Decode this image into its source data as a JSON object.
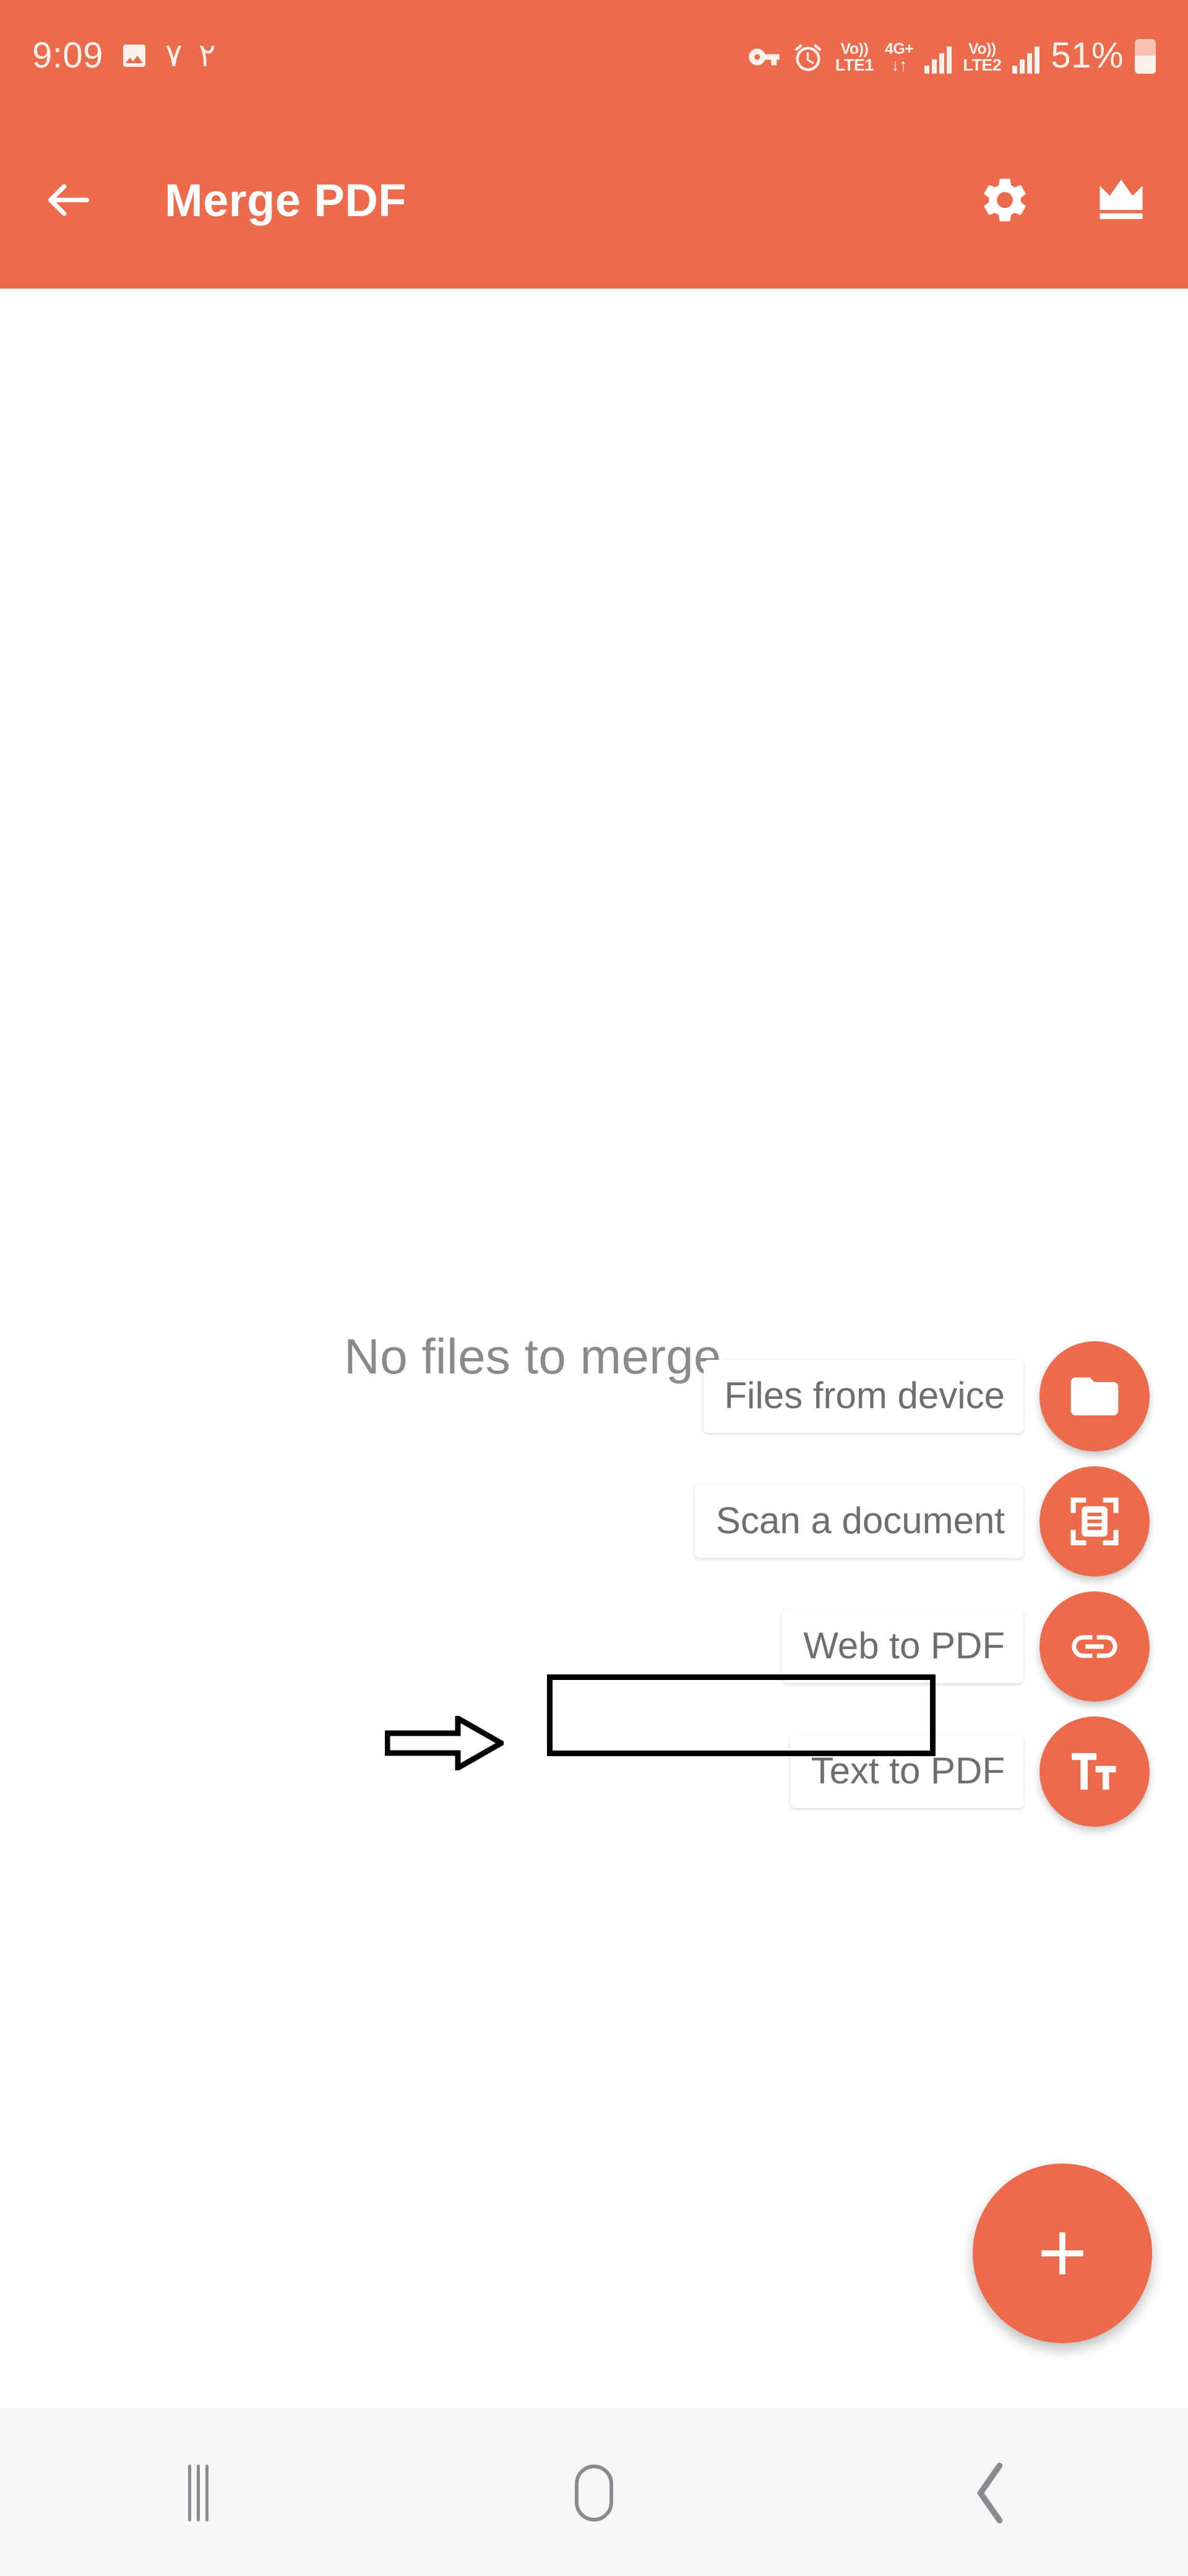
{
  "theme": {
    "accent": "#ec6b4c",
    "accent_light": "#fdf1ec",
    "label_text": "#6e6e6e",
    "empty_text": "#8a8a8a",
    "nav_background": "#f6f6f7",
    "nav_icon": "#8b8b8f",
    "annotation": "#000000"
  },
  "status_bar": {
    "time": "9:09",
    "left_icons": [
      "image-icon"
    ],
    "persian_digits": [
      "۷",
      "۲"
    ],
    "right_icons": [
      "vpn-key-icon",
      "alarm-icon"
    ],
    "sim1": {
      "volte_label": "Vo))",
      "network_label": "LTE1",
      "bars": 4
    },
    "data": {
      "type_label": "4G+",
      "arrows_label": "↓↑"
    },
    "sim2": {
      "volte_label": "Vo))",
      "network_label": "LTE2",
      "bars": 4
    },
    "battery_percent": "51%",
    "battery_level": 51
  },
  "app_bar": {
    "back_icon": "arrow-back-icon",
    "title": "Merge PDF",
    "actions": [
      {
        "name": "settings",
        "icon": "gear-icon"
      },
      {
        "name": "premium",
        "icon": "crown-icon"
      }
    ]
  },
  "main": {
    "empty_state_text": "No files to merge",
    "speed_dial": [
      {
        "label": "Files from device",
        "icon": "folder-icon"
      },
      {
        "label": "Scan a document",
        "icon": "document-scanner-icon"
      },
      {
        "label": "Web to PDF",
        "icon": "link-icon"
      },
      {
        "label": "Text to PDF",
        "icon": "text-format-icon"
      }
    ],
    "main_fab": {
      "icon": "plus-icon",
      "label": "Add"
    }
  },
  "annotations": {
    "highlight_target": "Files from device",
    "arrow_icon": "block-arrow-right-icon",
    "box_icon": "highlight-rectangle"
  },
  "nav_bar": {
    "buttons": [
      {
        "name": "recents",
        "icon": "recents-icon"
      },
      {
        "name": "home",
        "icon": "home-icon"
      },
      {
        "name": "back",
        "icon": "back-chevron-icon"
      }
    ]
  }
}
